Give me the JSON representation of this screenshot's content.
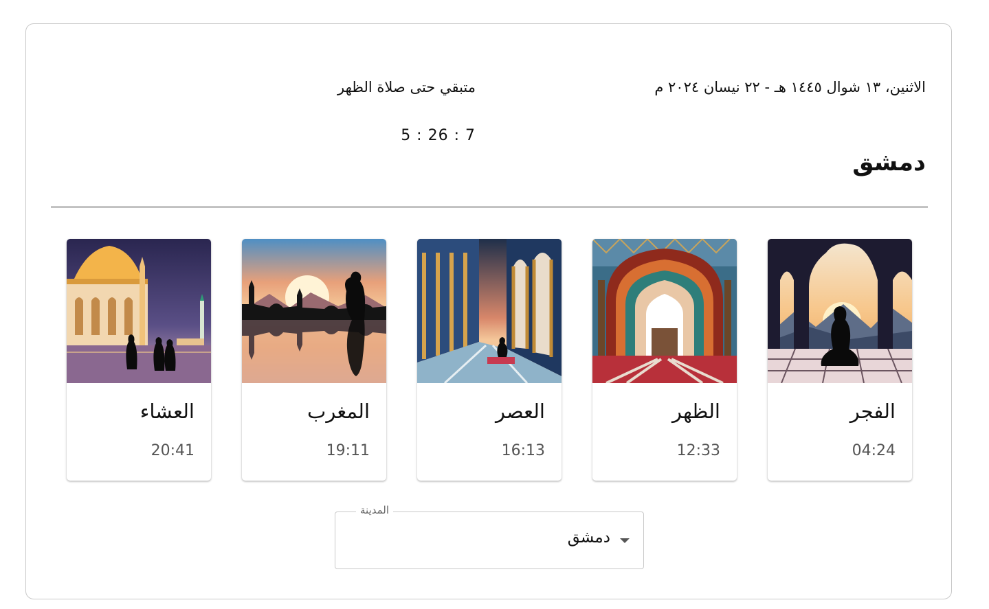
{
  "header": {
    "date": "الاثنين، ١٣ شوال ١٤٤٥ هـ - ٢٢ نيسان ٢٠٢٤ م",
    "countdown_label": "متبقي حتى صلاة الظهر",
    "countdown": "7 : 26 : 5",
    "city": "دمشق"
  },
  "prayers": [
    {
      "name": "الفجر",
      "time": "04:24",
      "image": "fajr-prayer-image"
    },
    {
      "name": "الظهر",
      "time": "12:33",
      "image": "dhuhr-mosque-arch-image"
    },
    {
      "name": "العصر",
      "time": "16:13",
      "image": "asr-mosque-hall-image"
    },
    {
      "name": "المغرب",
      "time": "19:11",
      "image": "maghrib-sunset-image"
    },
    {
      "name": "العشاء",
      "time": "20:41",
      "image": "isha-mosque-night-image"
    }
  ],
  "city_select": {
    "label": "المدينة",
    "value": "دمشق"
  },
  "colors": {
    "text": "#111111",
    "muted": "#555555",
    "border": "#c8c8c8"
  }
}
